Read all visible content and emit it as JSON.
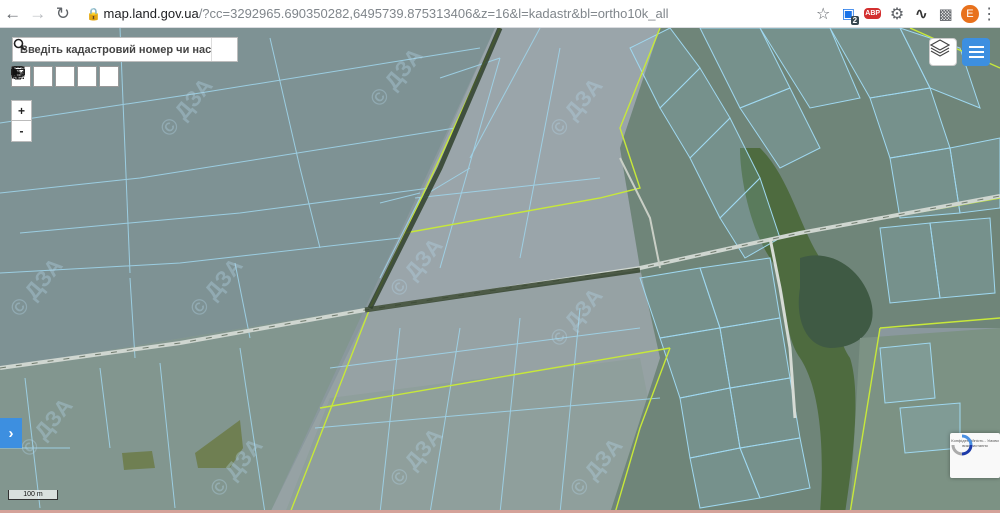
{
  "browser": {
    "back_icon": "arrow-left-icon",
    "forward_icon": "arrow-right-icon",
    "reload_icon": "reload-icon",
    "url_domain": "map.land.gov.ua",
    "url_rest": "/?cc=3292965.690350282,6495739.875313406&z=16&l=kadastr&bl=ortho10k_all",
    "ext_badge": "2",
    "abp_label": "ABP",
    "profile_initial": "E"
  },
  "search": {
    "placeholder": "Введіть кадастровий номер чи населений"
  },
  "zoom": {
    "in_label": "+",
    "out_label": "-"
  },
  "toolbar": {
    "tools": [
      "print-icon",
      "measure-distance-icon",
      "measure-area-icon",
      "select-cursor-icon",
      "info-icon"
    ]
  },
  "map": {
    "scale_label": "100 m",
    "watermark": "© ДЗА",
    "recaptcha_text": "Конфіденційність - Умови використання",
    "colors": {
      "parcel_outline": "#8fd0ec",
      "road_highlight": "#c7e83a",
      "accent_button": "#3d8fe0",
      "field_base": "#8c9aa0",
      "vegetation": "#4e6b3f"
    }
  }
}
